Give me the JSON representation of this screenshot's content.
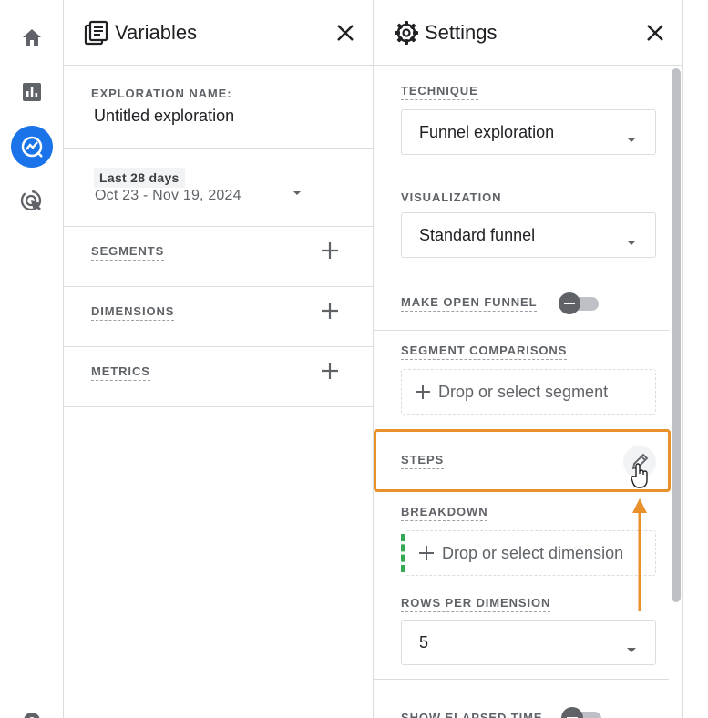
{
  "rail": {
    "items": [
      {
        "name": "home-icon"
      },
      {
        "name": "reports-icon"
      },
      {
        "name": "explore-icon",
        "active": true
      },
      {
        "name": "advertising-icon"
      },
      {
        "name": "admin-gear-icon"
      }
    ]
  },
  "variables": {
    "title": "Variables",
    "exploration_name_label": "EXPLORATION NAME:",
    "exploration_name": "Untitled exploration",
    "date_chip": "Last 28 days",
    "date_range": "Oct 23 - Nov 19, 2024",
    "sections": [
      {
        "label": "SEGMENTS"
      },
      {
        "label": "DIMENSIONS"
      },
      {
        "label": "METRICS"
      }
    ]
  },
  "settings": {
    "title": "Settings",
    "technique_label": "TECHNIQUE",
    "technique_value": "Funnel exploration",
    "visualization_label": "VISUALIZATION",
    "visualization_value": "Standard funnel",
    "open_funnel_label": "MAKE OPEN FUNNEL",
    "segment_comparisons_label": "SEGMENT COMPARISONS",
    "segment_drop": "Drop or select segment",
    "steps_label": "STEPS",
    "breakdown_label": "BREAKDOWN",
    "dimension_drop": "Drop or select dimension",
    "rows_per_dimension_label": "ROWS PER DIMENSION",
    "rows_per_dimension_value": "5",
    "show_elapsed_label": "SHOW ELAPSED TIME"
  },
  "colors": {
    "accent": "#1a73e8",
    "highlight": "#e8912b",
    "breakdown_edge": "#34a853"
  }
}
